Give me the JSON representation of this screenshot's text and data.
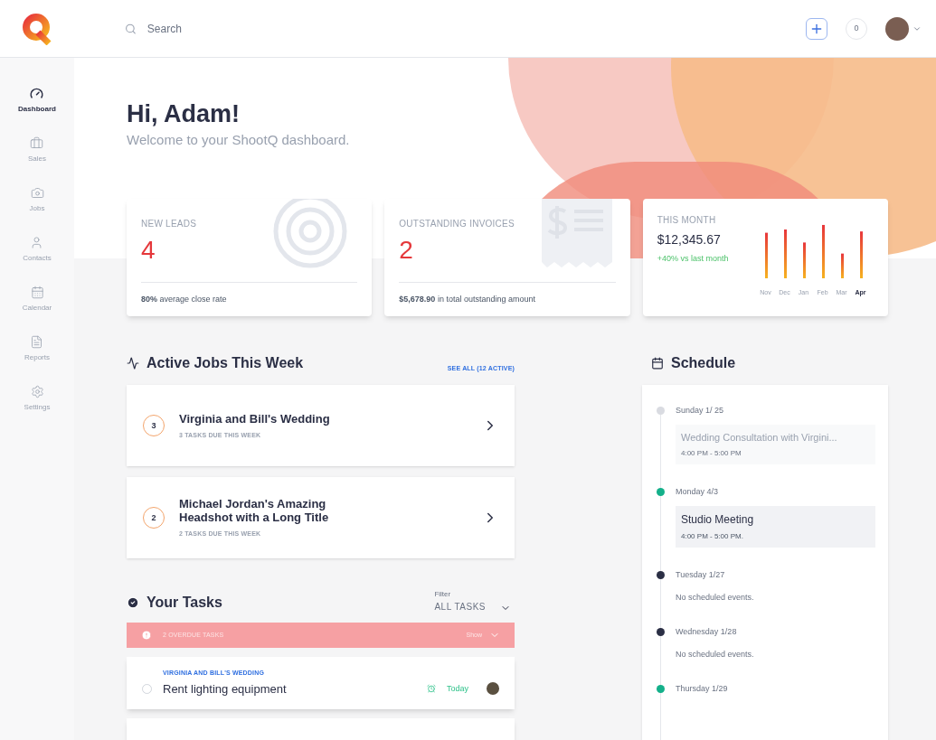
{
  "topbar": {
    "search": {
      "placeholder": "Search"
    },
    "notifications": "0"
  },
  "sidebar": {
    "items": [
      {
        "label": "Dashboard",
        "selected": true
      },
      {
        "label": "Sales",
        "selected": false
      },
      {
        "label": "Jobs",
        "selected": false
      },
      {
        "label": "Contacts",
        "selected": false
      },
      {
        "label": "Calendar",
        "selected": false
      },
      {
        "label": "Reports",
        "selected": false
      },
      {
        "label": "Settings",
        "selected": false
      }
    ]
  },
  "greeting": {
    "title": "Hi, Adam!",
    "subtitle": "Welcome to your ShootQ dashboard."
  },
  "stats": [
    {
      "kind": "count",
      "label": "NEW LEADS",
      "value": "4",
      "footer": "**80%** average close rate"
    },
    {
      "kind": "count",
      "label": "OUTSTANDING INVOICES",
      "value": "2",
      "footer": "**$5,678.90** in total outstanding amount"
    },
    {
      "kind": "revenue",
      "label": "THIS MONTH",
      "value": "$12,345.67",
      "change": "+40% vs last month",
      "months": [
        {
          "label": "Nov",
          "selected": false
        },
        {
          "label": "Dec",
          "selected": false
        },
        {
          "label": "Jan",
          "selected": false
        },
        {
          "label": "Feb",
          "selected": false
        },
        {
          "label": "Mar",
          "selected": false
        },
        {
          "label": "Apr",
          "selected": true
        }
      ]
    }
  ],
  "active_jobs": {
    "title": "Active Jobs This Week",
    "link": "SEE ALL (12 ACTIVE)",
    "jobs": [
      {
        "count": "3",
        "title": "Virginia and Bill's Wedding",
        "subtitle": "3 TASKS DUE THIS WEEK"
      },
      {
        "count": "2",
        "title": "Michael Jordan's Amazing Headshot with a Long Title",
        "subtitle": "2 TASKS DUE THIS WEEK"
      }
    ]
  },
  "tasks": {
    "title": "Your Tasks",
    "filter_label": "Filter",
    "filter_value": "ALL TASKS",
    "overdue": {
      "text": "2 OVERDUE TASKS",
      "action": "Show"
    },
    "items": [
      {
        "job": "VIRGINIA AND BILL'S WEDDING",
        "title": "Rent lighting equipment",
        "due": "Today",
        "checked": false
      }
    ]
  },
  "schedule": {
    "title": "Schedule",
    "days": [
      {
        "day": "Sunday 1/ 25",
        "color": "#d9dbe1",
        "kind": "event",
        "past": true,
        "event": "Wedding Consultation with Virgini...",
        "time": "4:00 PM - 5:00 PM"
      },
      {
        "day": "Monday 4/3",
        "color": "#14b08a",
        "kind": "event",
        "past": false,
        "event": "Studio Meeting",
        "time": "4:00 PM - 5:00 PM."
      },
      {
        "day": "Tuesday 1/27",
        "color": "#2b2f45",
        "kind": "empty",
        "note": "No scheduled events."
      },
      {
        "day": "Wednesday 1/28",
        "color": "#2b2f45",
        "kind": "empty",
        "note": "No scheduled events."
      },
      {
        "day": "Thursday 1/29",
        "color": "#14b08a",
        "kind": "empty"
      }
    ]
  }
}
